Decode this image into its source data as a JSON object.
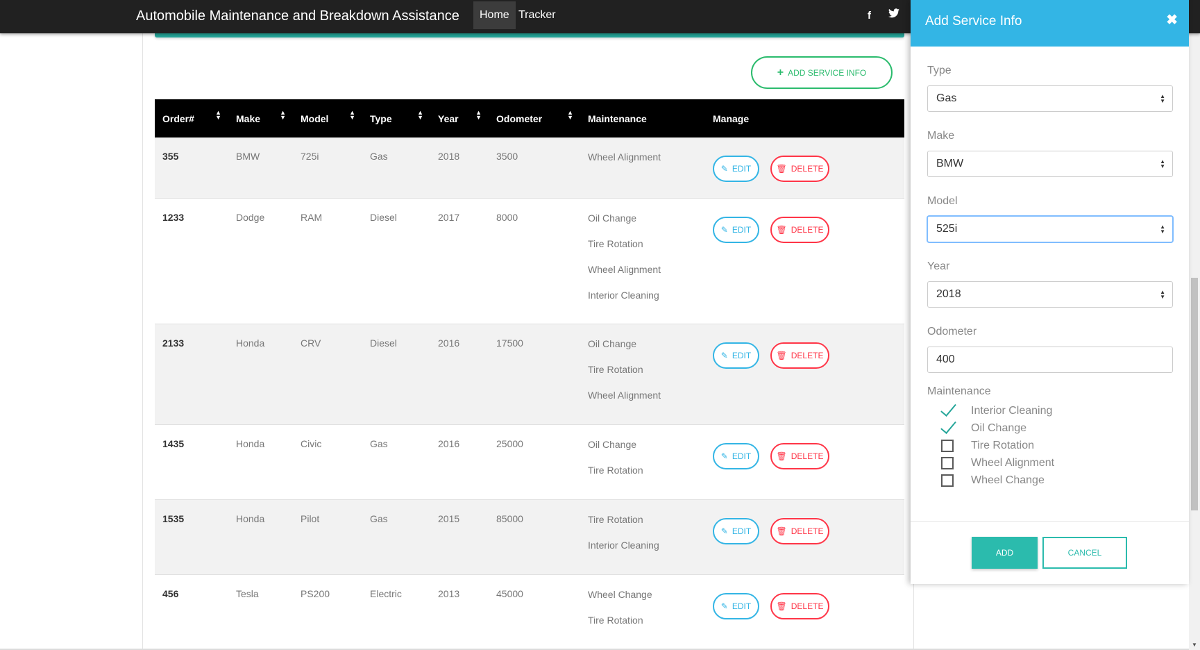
{
  "nav": {
    "brand": "Automobile Maintenance and Breakdown Assistance",
    "home": "Home",
    "tracker": "Tracker",
    "facebook_icon": "f",
    "twitter_icon": "twitter"
  },
  "toolbar": {
    "add_label": "ADD SERVICE INFO"
  },
  "table": {
    "headers": [
      "Order#",
      "Make",
      "Model",
      "Type",
      "Year",
      "Odometer",
      "Maintenance",
      "Manage"
    ],
    "edit_label": "EDIT",
    "delete_label": "DELETE",
    "rows": [
      {
        "order": "355",
        "make": "BMW",
        "model": "725i",
        "type": "Gas",
        "year": "2018",
        "odometer": "3500",
        "maintenance": [
          "Wheel Alignment"
        ]
      },
      {
        "order": "1233",
        "make": "Dodge",
        "model": "RAM",
        "type": "Diesel",
        "year": "2017",
        "odometer": "8000",
        "maintenance": [
          "Oil Change",
          "Tire Rotation",
          "Wheel Alignment",
          "Interior Cleaning"
        ]
      },
      {
        "order": "2133",
        "make": "Honda",
        "model": "CRV",
        "type": "Diesel",
        "year": "2016",
        "odometer": "17500",
        "maintenance": [
          "Oil Change",
          "Tire Rotation",
          "Wheel Alignment"
        ]
      },
      {
        "order": "1435",
        "make": "Honda",
        "model": "Civic",
        "type": "Gas",
        "year": "2016",
        "odometer": "25000",
        "maintenance": [
          "Oil Change",
          "Tire Rotation"
        ]
      },
      {
        "order": "1535",
        "make": "Honda",
        "model": "Pilot",
        "type": "Gas",
        "year": "2015",
        "odometer": "85000",
        "maintenance": [
          "Tire Rotation",
          "Interior Cleaning"
        ]
      },
      {
        "order": "456",
        "make": "Tesla",
        "model": "PS200",
        "type": "Electric",
        "year": "2013",
        "odometer": "45000",
        "maintenance": [
          "Wheel Change",
          "Tire Rotation"
        ]
      }
    ]
  },
  "panel": {
    "title": "Add Service Info",
    "close_icon": "✖",
    "type_label": "Type",
    "type_value": "Gas",
    "make_label": "Make",
    "make_value": "BMW",
    "model_label": "Model",
    "model_value": "525i",
    "year_label": "Year",
    "year_value": "2018",
    "odometer_label": "Odometer",
    "odometer_value": "400",
    "maintenance_label": "Maintenance",
    "checks": [
      {
        "label": "Interior Cleaning",
        "checked": true
      },
      {
        "label": "Oil Change",
        "checked": true
      },
      {
        "label": "Tire Rotation",
        "checked": false
      },
      {
        "label": "Wheel Alignment",
        "checked": false
      },
      {
        "label": "Wheel Change",
        "checked": false
      }
    ],
    "add_label": "ADD",
    "cancel_label": "CANCEL"
  },
  "colors": {
    "accent_blue": "#33b5e5",
    "accent_teal": "#2bbbad",
    "danger": "#ff3547",
    "success": "#2bbb6d"
  }
}
